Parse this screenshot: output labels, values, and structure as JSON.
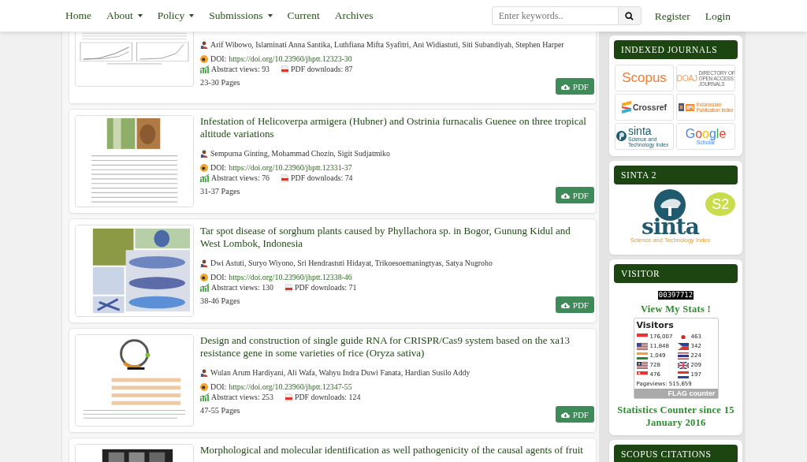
{
  "nav": {
    "items": [
      {
        "label": "Home",
        "dropdown": false
      },
      {
        "label": "About",
        "dropdown": true
      },
      {
        "label": "Policy",
        "dropdown": true
      },
      {
        "label": "Submissions",
        "dropdown": true
      },
      {
        "label": "Current",
        "dropdown": false
      },
      {
        "label": "Archives",
        "dropdown": false
      }
    ],
    "search": {
      "placeholder": "Enter keywords.."
    },
    "links": [
      "Register",
      "Login"
    ]
  },
  "articles": [
    {
      "authors": "Arif Wibowo, Islaminati Anna Santika, Luthfiana Mifta Syafitri, Ani Widiastuti, Siti Subandiyah, Stephen Harper",
      "doi_label": "DOI:",
      "doi": "https://doi.org/10.23960/jhptt.12323-30",
      "views": "Abstract views: 93",
      "downloads": "PDF downloads: 87",
      "pages": "23-30 Pages",
      "button": "PDF"
    },
    {
      "title": "Infestation of Helicoverpa armigera (Hubner) and Ostrinia furnacalis Guenee on three tropical altitude variations",
      "authors": "Sempurna Ginting, Mohammad Chozin, Sigit Sudjatmiko",
      "doi_label": "DOI:",
      "doi": "https://doi.org/10.23960/jhptt.12331-37",
      "views": "Abstract views: 76",
      "downloads": "PDF downloads: 74",
      "pages": "31-37 Pages",
      "button": "PDF"
    },
    {
      "title": "Tar spot disease of sorghum plants caused by Phyllachora sp. in Bogor, Gunung Kidul and West Lombok, Indonesia",
      "authors": "Dwi Astuti, Suryo Wiyono, Sri Hendrastuti Hidayat, Trikoesoemaningtyas, Satya Nugroho",
      "doi_label": "DOI:",
      "doi": "https://doi.org/10.23960/jhptt.12338-46",
      "views": "Abstract views: 130",
      "downloads": "PDF downloads: 71",
      "pages": "38-46 Pages",
      "button": "PDF"
    },
    {
      "title": "Design and construction of single guide RNA for CRISPR/Cas9 system based on the xa13 resistance gene in some varieties of rice (Oryza sativa)",
      "authors": "Wulan Arum Hardiyani, Ali Wafa, Wahyu Indra Duwi Fanata, Hardian Susilo Addy",
      "doi_label": "DOI:",
      "doi": "https://doi.org/10.23960/jhptt.12347-55",
      "views": "Abstract views: 253",
      "downloads": "PDF downloads: 124",
      "pages": "47-55 Pages",
      "button": "PDF"
    },
    {
      "title": "Morphological and molecular identification as well pathogenicity of the causal agents of fruit"
    }
  ],
  "sidebar": [
    {
      "kind": "logos",
      "title": "INDEXED JOURNALS",
      "logos": [
        {
          "kind": "scopus",
          "texts": [
            "Scopus"
          ]
        },
        {
          "kind": "doaj",
          "texts": [
            "DOAJ",
            "DIRECTORY OF",
            "OPEN ACCESS",
            "JOURNALS"
          ]
        },
        {
          "kind": "crossref",
          "texts": [
            "Crossref"
          ]
        },
        {
          "kind": "ipi",
          "texts": [
            "IPI",
            "Indonesian",
            "Publication Index"
          ]
        },
        {
          "kind": "sinta",
          "texts": [
            "sinta",
            "Science and Technology Index"
          ]
        },
        {
          "kind": "google",
          "texts": [
            "Google",
            "Scholar"
          ]
        }
      ]
    },
    {
      "kind": "sinta",
      "title": "SINTA 2",
      "logo": "sinta",
      "badge": "S2",
      "tagline": "Science and Technology Index"
    },
    {
      "kind": "visitor",
      "title": "VISITOR",
      "counter": "00397712",
      "stats_link": "View My Stats !",
      "widget": {
        "title": "Visitors",
        "countries": [
          {
            "kind": "id",
            "count": "176,007"
          },
          {
            "kind": "us",
            "count": "11,848"
          },
          {
            "kind": "in",
            "count": "1,049"
          },
          {
            "kind": "my",
            "count": "728"
          },
          {
            "kind": "sg",
            "count": "476"
          },
          {
            "kind": "jp",
            "count": "463"
          },
          {
            "kind": "ph",
            "count": "342"
          },
          {
            "kind": "th",
            "count": "224"
          },
          {
            "kind": "gb",
            "count": "209"
          },
          {
            "kind": "nl",
            "count": "197"
          }
        ],
        "pageviews": "Pageviews: 515,659",
        "brand": [
          "FLAG",
          "counter"
        ]
      },
      "caption": "Statistics Counter since 15 January 2016"
    },
    {
      "kind": "heading",
      "title": "SCOPUS CITATIONS"
    }
  ]
}
